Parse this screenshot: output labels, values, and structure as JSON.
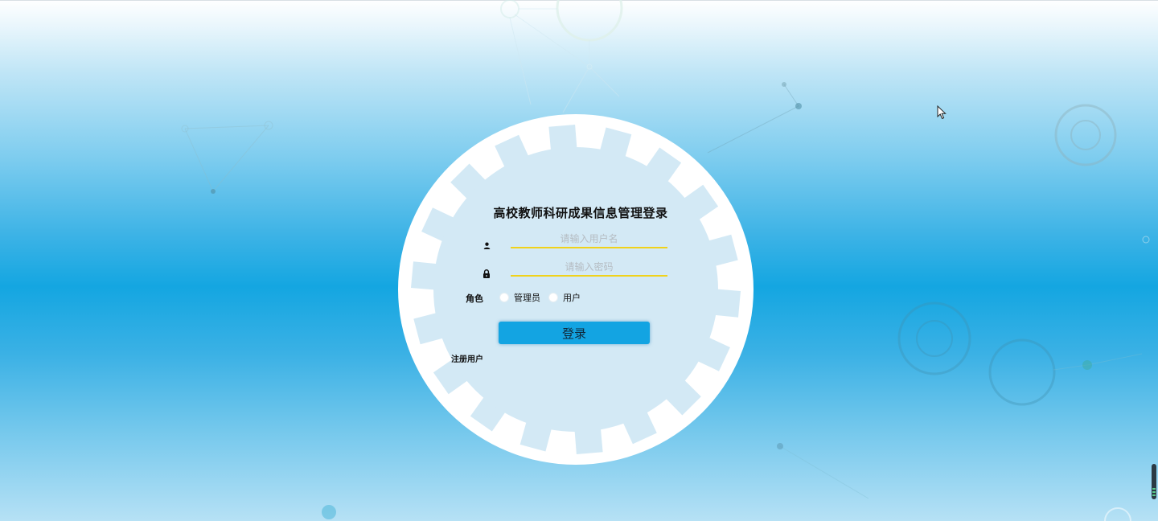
{
  "login": {
    "title": "高校教师科研成果信息管理登录",
    "username_placeholder": "请输入用户名",
    "password_placeholder": "请输入密码",
    "role_label": "角色",
    "role_options": [
      "管理员",
      "用户"
    ],
    "login_button": "登录",
    "register_link": "注册用户"
  },
  "icons": {
    "username": "user-icon",
    "password": "lock-icon",
    "cursor": "mouse-pointer-icon"
  },
  "colors": {
    "input_underline": "#f0d21b",
    "button": "#13a4e2",
    "panel": "#d3e9f5",
    "background_center": "#14a6e1"
  }
}
